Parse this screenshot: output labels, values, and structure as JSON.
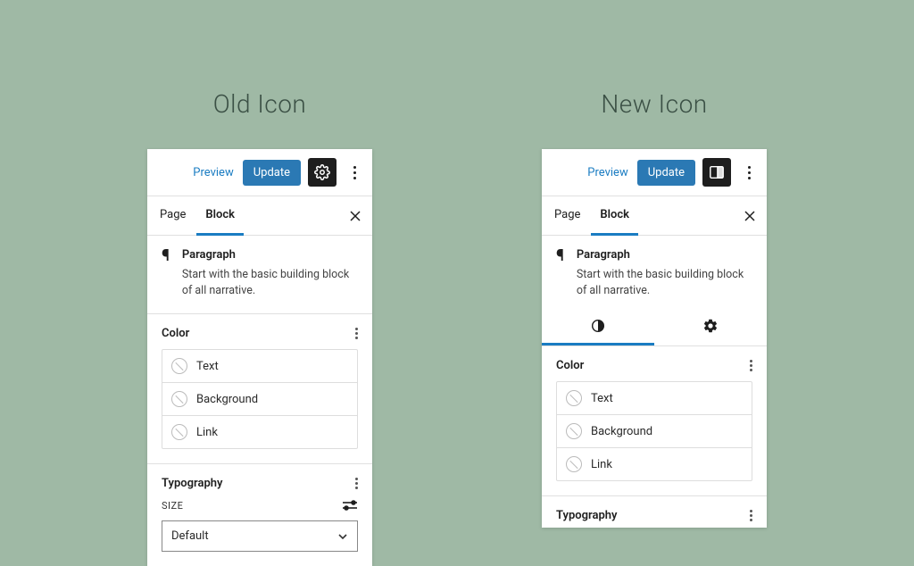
{
  "headings": {
    "left": "Old Icon",
    "right": "New Icon"
  },
  "header": {
    "preview": "Preview",
    "update": "Update"
  },
  "tabs": {
    "page": "Page",
    "block": "Block"
  },
  "block": {
    "name": "Paragraph",
    "description": "Start with the basic building block of all narrative."
  },
  "sections": {
    "color": {
      "title": "Color",
      "items": [
        "Text",
        "Background",
        "Link"
      ]
    },
    "typography": {
      "title": "Typography",
      "size_label": "SIZE",
      "select_default": "Default"
    }
  }
}
